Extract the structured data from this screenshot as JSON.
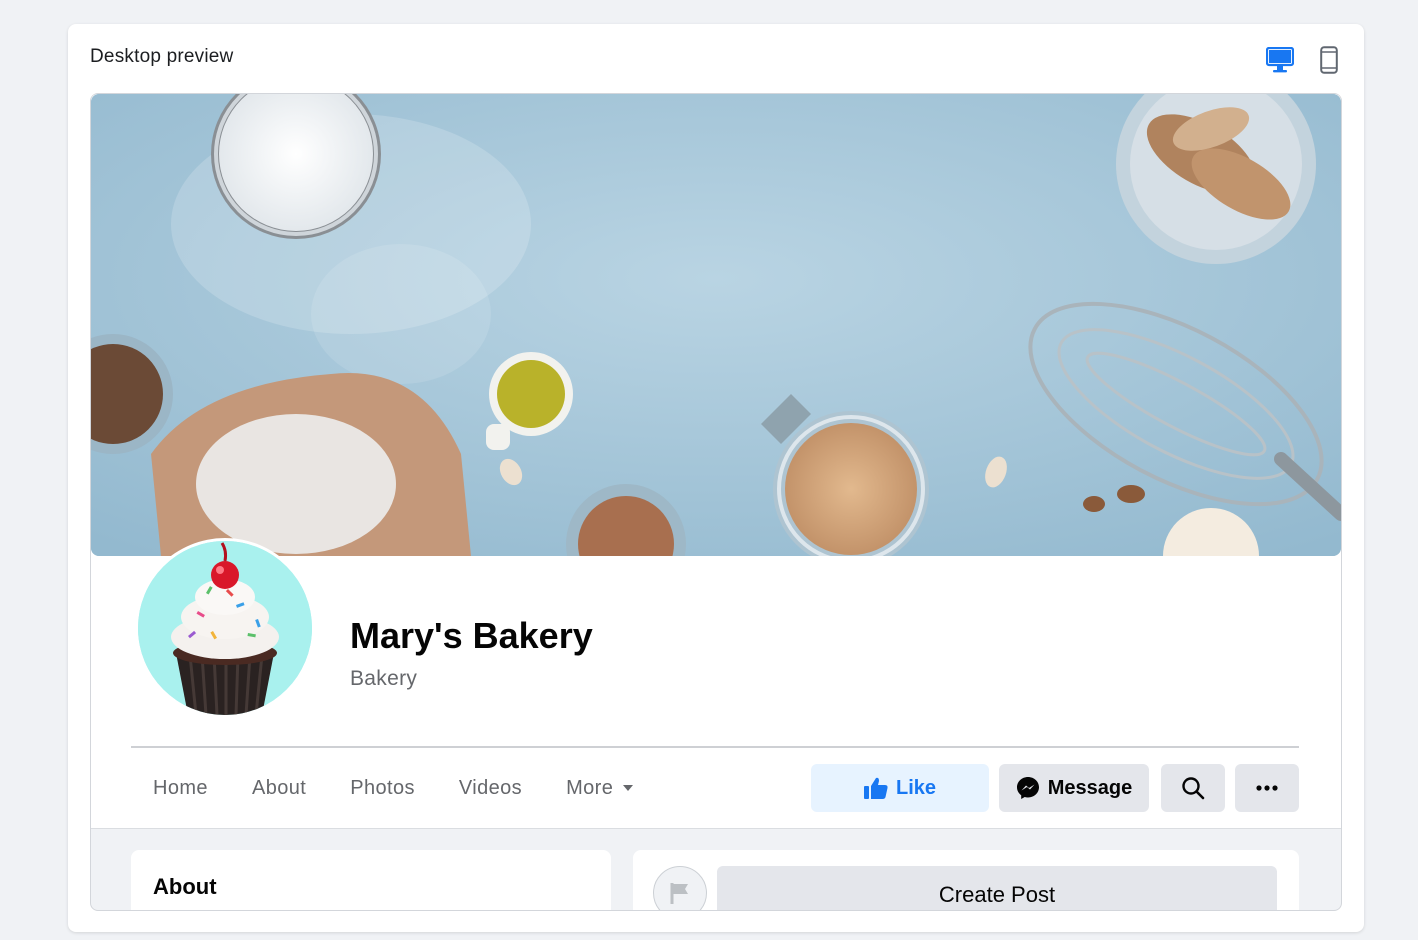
{
  "preview": {
    "title": "Desktop preview",
    "devices": [
      {
        "name": "desktop",
        "icon": "desktop-icon",
        "selected": true
      },
      {
        "name": "mobile",
        "icon": "mobile-phone-icon",
        "selected": false
      }
    ]
  },
  "page": {
    "name": "Mary's Bakery",
    "category": "Bakery",
    "cover_image": "baking-ingredients-cover-photo",
    "profile_image": "cupcake-profile-photo"
  },
  "nav": {
    "tabs": [
      {
        "label": "Home"
      },
      {
        "label": "About"
      },
      {
        "label": "Photos"
      },
      {
        "label": "Videos"
      },
      {
        "label": "More"
      }
    ]
  },
  "actions": {
    "like_label": "Like",
    "message_label": "Message",
    "search_icon": "search-icon",
    "more_icon": "ellipsis-icon"
  },
  "sections": {
    "about_title": "About",
    "create_post_label": "Create Post"
  },
  "colors": {
    "accent": "#1877f2",
    "like_bg": "#e7f3ff",
    "button_bg": "#e4e6eb"
  }
}
